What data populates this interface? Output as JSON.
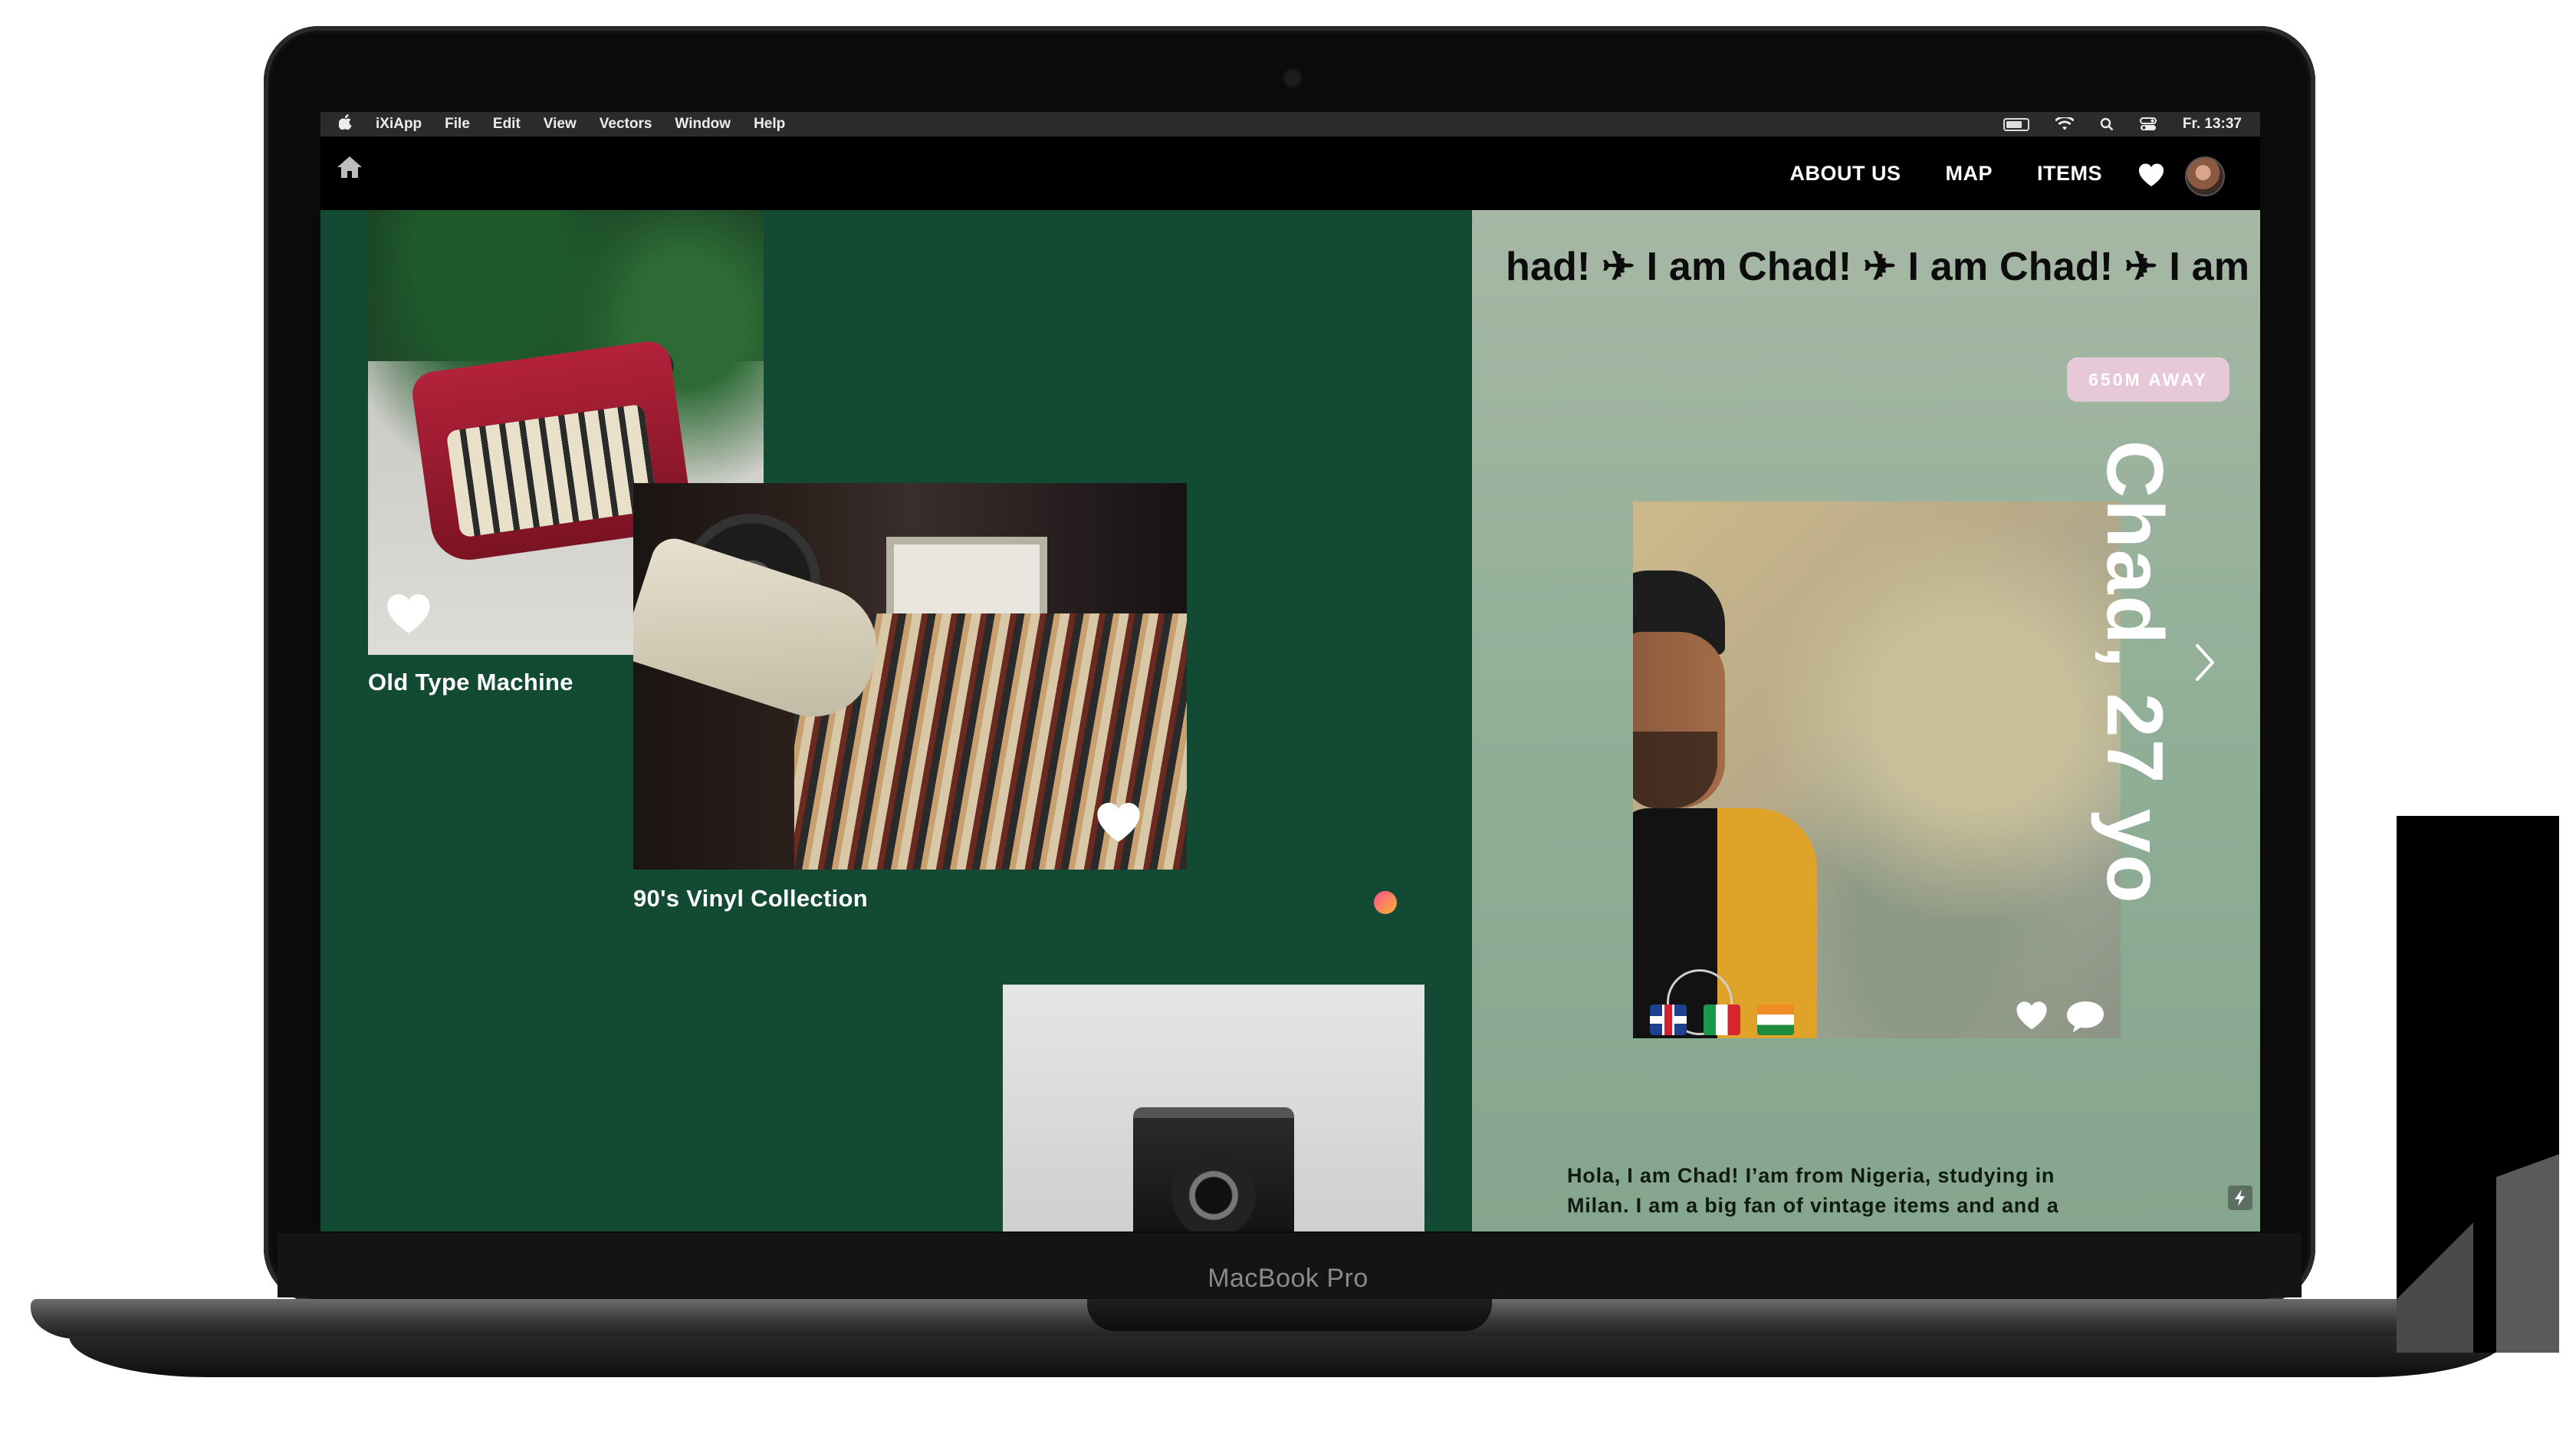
{
  "device": {
    "model_label": "MacBook Pro"
  },
  "menubar": {
    "apple_icon": "apple-icon",
    "items": [
      "iXiApp",
      "File",
      "Edit",
      "View",
      "Vectors",
      "Window",
      "Help"
    ],
    "status_icons": [
      "battery-icon",
      "wifi-icon",
      "search-icon",
      "control-center-icon"
    ],
    "clock": "Fr. 13:37"
  },
  "navbar": {
    "home_icon": "home-icon",
    "links": [
      "ABOUT US",
      "MAP",
      "ITEMS"
    ],
    "heart_icon": "heart-icon",
    "avatar_icon": "avatar"
  },
  "feed": {
    "background_color": "#124a33",
    "cards": [
      {
        "title": "Old Type Machine"
      },
      {
        "title": "90's Vinyl Collection"
      },
      {
        "title": ""
      }
    ]
  },
  "profile": {
    "marquee_text": "had!  ✈ I am Chad!  ✈ I am Chad!  ✈  I am C",
    "distance_badge": "650M AWAY",
    "name_age": "Chad, 27 yo",
    "flags": [
      "flag-uk",
      "flag-italy",
      "flag-niger"
    ],
    "bio": "Hola, I am Chad! I’am from Nigeria, studying in Milan. I am a big fan of vintage items and and a",
    "accent_color": "#e7c8d7"
  }
}
